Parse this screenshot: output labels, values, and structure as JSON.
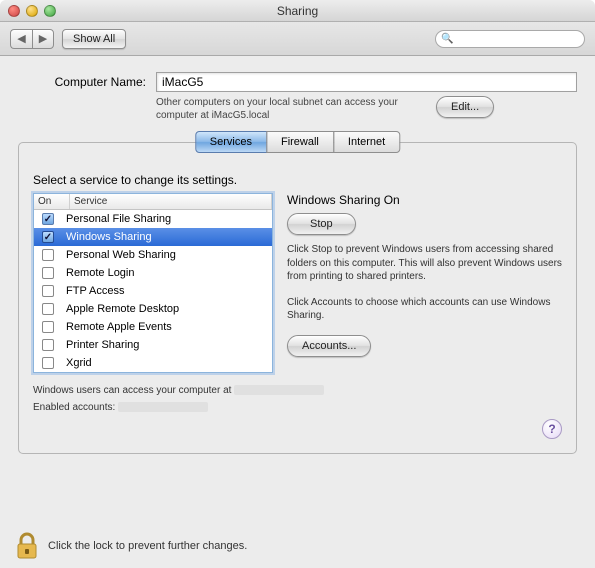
{
  "window": {
    "title": "Sharing"
  },
  "toolbar": {
    "show_all": "Show All",
    "search_placeholder": ""
  },
  "computer_name": {
    "label": "Computer Name:",
    "value": "iMacG5",
    "hint": "Other computers on your local subnet can access your computer at iMacG5.local",
    "edit_btn": "Edit..."
  },
  "tabs": {
    "items": [
      "Services",
      "Firewall",
      "Internet"
    ],
    "selected_index": 0
  },
  "prompt": "Select a service to change its settings.",
  "services_table": {
    "headers": {
      "on": "On",
      "service": "Service"
    },
    "rows": [
      {
        "on": true,
        "name": "Personal File Sharing",
        "selected": false
      },
      {
        "on": true,
        "name": "Windows Sharing",
        "selected": true
      },
      {
        "on": false,
        "name": "Personal Web Sharing",
        "selected": false
      },
      {
        "on": false,
        "name": "Remote Login",
        "selected": false
      },
      {
        "on": false,
        "name": "FTP Access",
        "selected": false
      },
      {
        "on": false,
        "name": "Apple Remote Desktop",
        "selected": false
      },
      {
        "on": false,
        "name": "Remote Apple Events",
        "selected": false
      },
      {
        "on": false,
        "name": "Printer Sharing",
        "selected": false
      },
      {
        "on": false,
        "name": "Xgrid",
        "selected": false
      }
    ]
  },
  "detail": {
    "title": "Windows Sharing On",
    "stop_btn": "Stop",
    "desc1": "Click Stop to prevent Windows users from accessing shared folders on this computer. This will also prevent Windows users from printing to shared printers.",
    "desc2": "Click Accounts to choose which accounts can use Windows Sharing.",
    "accounts_btn": "Accounts..."
  },
  "status": {
    "line1": "Windows users can access your computer at ",
    "line2_label": "Enabled accounts:"
  },
  "lock": {
    "text": "Click the lock to prevent further changes."
  }
}
